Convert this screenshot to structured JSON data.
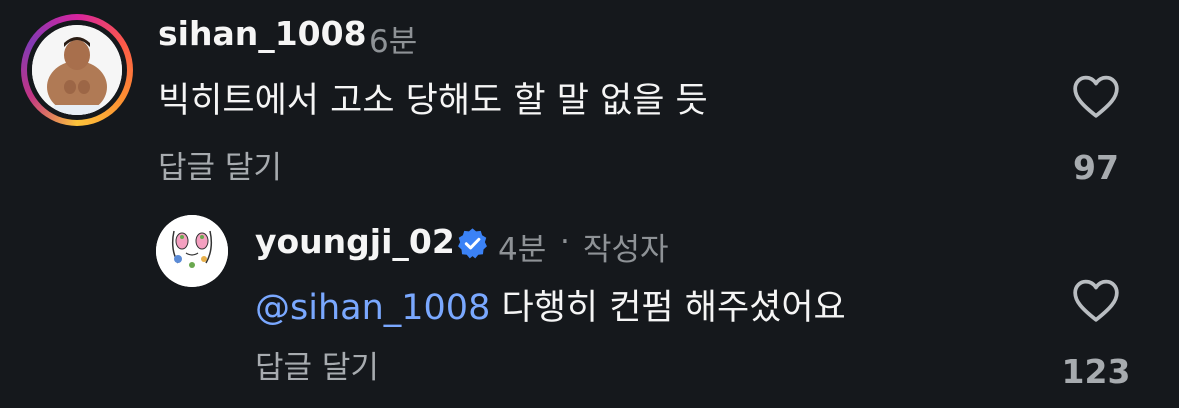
{
  "comments": [
    {
      "username": "sihan_1008",
      "time": "6분",
      "text": "빅히트에서 고소 당해도 할 말 없을 듯",
      "reply_label": "답글 달기",
      "likes": "97",
      "story_ring": true,
      "verified": false
    },
    {
      "username": "youngji_02",
      "time": "4분",
      "separator": "·",
      "author_badge": "작성자",
      "mention": "@sihan_1008",
      "text": "다행히 컨펌 해주셨어요",
      "reply_label": "답글 달기",
      "likes": "123",
      "verified": true
    }
  ],
  "icons": {
    "like": "heart-outline-icon",
    "verified": "verified-badge-icon"
  },
  "colors": {
    "background": "#15181c",
    "mention": "#7aa8ff",
    "verified": "#3b82f6",
    "muted": "#8e9296"
  }
}
